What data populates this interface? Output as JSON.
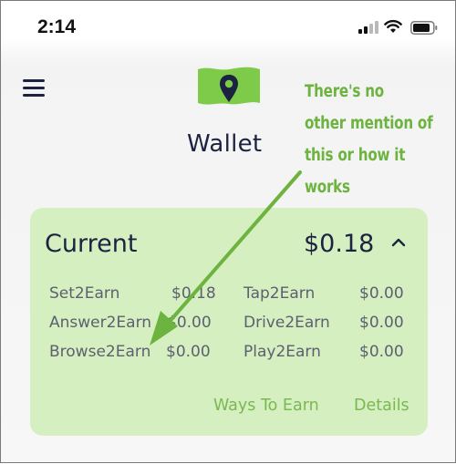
{
  "status_bar": {
    "time": "2:14"
  },
  "header": {
    "title": "Wallet",
    "icons": [
      "menu-icon",
      "location-pin-icon",
      "signal-icon",
      "wifi-icon",
      "battery-icon"
    ]
  },
  "annotation": {
    "lines": [
      "There's no",
      "other mention of",
      "this or how it",
      "works"
    ],
    "color": "#6db33f"
  },
  "wallet_card": {
    "title": "Current",
    "total": "$0.18",
    "background": "#d6efc0",
    "items": [
      {
        "label": "Set2Earn",
        "value": "$0.18"
      },
      {
        "label": "Tap2Earn",
        "value": "$0.00"
      },
      {
        "label": "Answer2Earn",
        "value": "$0.00"
      },
      {
        "label": "Drive2Earn",
        "value": "$0.00"
      },
      {
        "label": "Browse2Earn",
        "value": "$0.00"
      },
      {
        "label": "Play2Earn",
        "value": "$0.00"
      }
    ],
    "links": {
      "ways_to_earn": "Ways To Earn",
      "details": "Details"
    },
    "link_color": "#7ab852"
  }
}
